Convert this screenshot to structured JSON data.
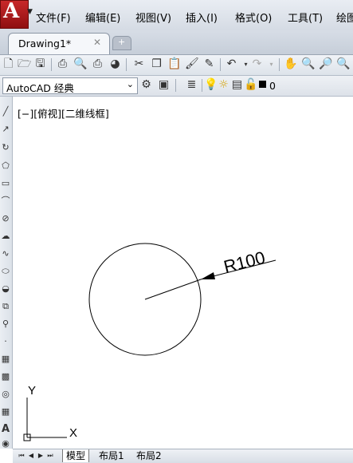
{
  "app": {
    "logo_letter": "A"
  },
  "menu": {
    "items": [
      {
        "label": "文件(F)"
      },
      {
        "label": "编辑(E)"
      },
      {
        "label": "视图(V)"
      },
      {
        "label": "插入(I)"
      },
      {
        "label": "格式(O)"
      },
      {
        "label": "工具(T)"
      },
      {
        "label": "绘图"
      }
    ]
  },
  "tabs": {
    "document": "Drawing1*",
    "close_glyph": "✕",
    "new_tab_glyph": "+"
  },
  "workspace": {
    "name": "AutoCAD 经典",
    "current_layer": "0"
  },
  "viewport": {
    "label": "[−][俯视][二维线框]"
  },
  "drawing": {
    "dimension_text": "R100",
    "ucs_x": "X",
    "ucs_y": "Y"
  },
  "layout_tabs": [
    {
      "label": "模型"
    },
    {
      "label": "布局1"
    },
    {
      "label": "布局2"
    }
  ],
  "colors": {
    "accent_red": "#b51c1d",
    "toolbar_bg": "#e3e8ee"
  }
}
